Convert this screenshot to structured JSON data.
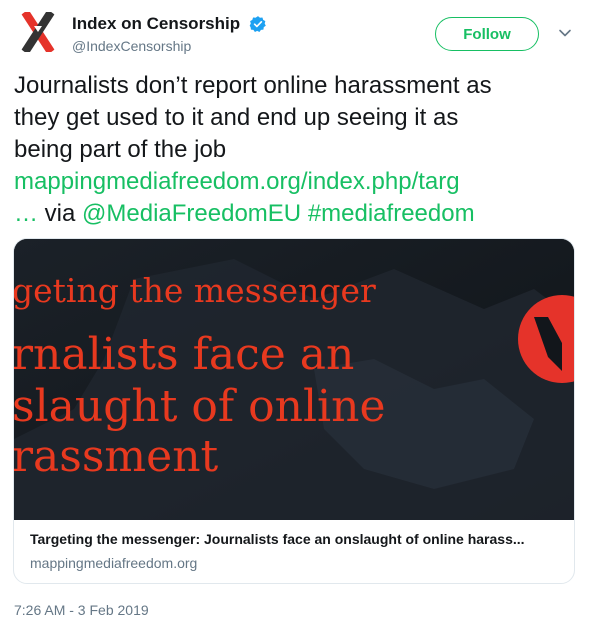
{
  "account": {
    "display_name": "Index on Censorship",
    "handle": "@IndexCensorship",
    "follow_label": "Follow"
  },
  "tweet": {
    "text_line1": "Journalists don’t report online harassment as",
    "text_line2": "they get used to it and end up seeing it as",
    "text_line3": "being part of the job",
    "link_text": "mappingmediafreedom.org/index.php/targ",
    "ellipsis": "…",
    "via": "via",
    "mention": "@MediaFreedomEU",
    "hashtag": "#mediafreedom"
  },
  "card": {
    "image_line1": "geting the messenger",
    "image_line2": "rnalists face an",
    "image_line3": "slaught of online",
    "image_line4": "rassment",
    "title": "Targeting the messenger: Journalists face an onslaught of online harass...",
    "domain": "mappingmediafreedom.org"
  },
  "timestamp": "7:26 AM - 3 Feb 2019",
  "colors": {
    "link": "#17bf63",
    "follow": "#17bf63",
    "verified": "#1da1f2",
    "image_text": "#e8391f",
    "logo_red": "#e5332a",
    "avatar_dark": "#333333"
  }
}
